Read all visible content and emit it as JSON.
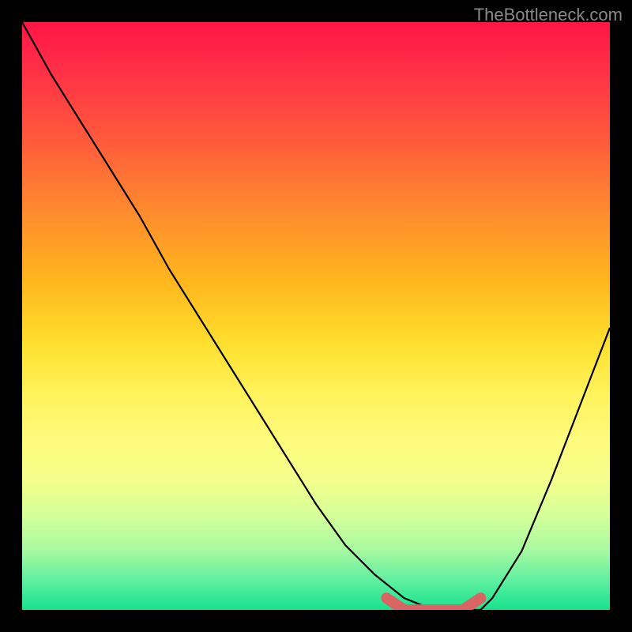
{
  "watermark": "TheBottleneck.com",
  "chart_data": {
    "type": "line",
    "title": "",
    "xlabel": "",
    "ylabel": "",
    "xlim": [
      0,
      100
    ],
    "ylim": [
      0,
      100
    ],
    "background": {
      "gradient": [
        {
          "pos": 0,
          "color": "#ff1646"
        },
        {
          "pos": 20,
          "color": "#ff5a3c"
        },
        {
          "pos": 44,
          "color": "#ffb61c"
        },
        {
          "pos": 63,
          "color": "#fff25a"
        },
        {
          "pos": 84,
          "color": "#d4ff9a"
        },
        {
          "pos": 100,
          "color": "#18e28e"
        }
      ]
    },
    "series": [
      {
        "name": "curve",
        "color": "#000000",
        "x": [
          0,
          5,
          10,
          15,
          20,
          25,
          30,
          35,
          40,
          45,
          50,
          55,
          60,
          65,
          70,
          72,
          74,
          76,
          78,
          80,
          85,
          90,
          95,
          100
        ],
        "y": [
          100,
          91,
          83,
          75,
          67,
          58,
          50,
          42,
          34,
          26,
          18,
          11,
          6,
          2,
          0,
          0,
          0,
          0,
          0,
          2,
          10,
          22,
          35,
          48
        ]
      },
      {
        "name": "highlight-segment",
        "color": "#d86464",
        "x": [
          62,
          65,
          70,
          75,
          78
        ],
        "y": [
          2,
          0,
          0,
          0,
          2
        ]
      }
    ],
    "markers": [
      {
        "name": "highlight-dot",
        "x": 78,
        "y": 2,
        "color": "#d86464",
        "r": 6
      }
    ]
  }
}
